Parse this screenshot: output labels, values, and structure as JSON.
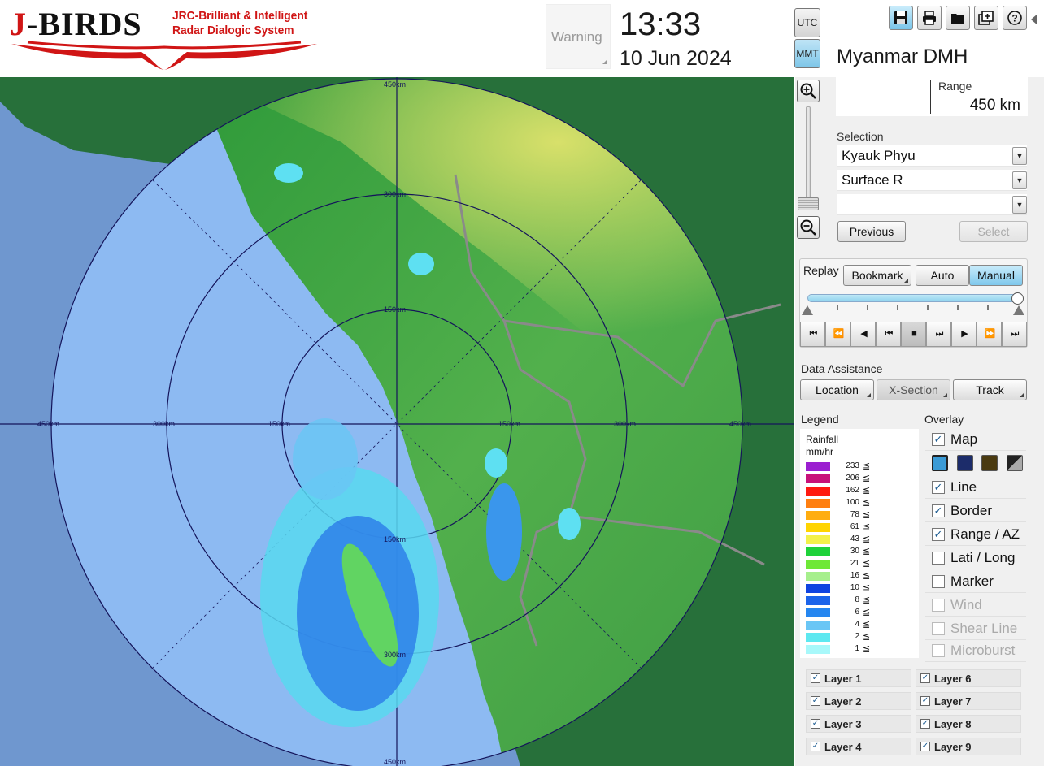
{
  "app": {
    "logo_main": "J-BIRDS",
    "logo_sub_line1": "JRC-Brilliant & Intelligent",
    "logo_sub_line2": "Radar Dialogic System"
  },
  "header": {
    "warning_label": "Warning",
    "time": "13:33",
    "date": "10 Jun 2024",
    "tz_utc": "UTC",
    "tz_mmt": "MMT",
    "active_tz": "MMT",
    "station": "Myanmar DMH",
    "tools": [
      "save-icon",
      "print-icon",
      "open-folder-icon",
      "add-window-icon",
      "help-icon"
    ]
  },
  "map": {
    "range_ring_labels": {
      "north": [
        "450km",
        "300km",
        "150km"
      ],
      "south": [
        "150km",
        "300km",
        "450km"
      ],
      "west": [
        "450km",
        "300km",
        "150km"
      ],
      "east": [
        "150km",
        "300km",
        "450km"
      ]
    }
  },
  "panel": {
    "range_label": "Range",
    "range_value": "450 km",
    "selection_label": "Selection",
    "selection_site": "Kyauk Phyu",
    "selection_product": "Surface R",
    "selection_third": "",
    "previous_label": "Previous",
    "select_label": "Select",
    "replay_label": "Replay",
    "bookmark_label": "Bookmark",
    "auto_label": "Auto",
    "manual_label": "Manual",
    "replay_mode": "Manual",
    "transport_buttons": [
      "⏮",
      "⏪",
      "◀",
      "⏮",
      "■",
      "⏭",
      "▶",
      "⏩",
      "⏭"
    ],
    "data_assistance_label": "Data Assistance",
    "location_label": "Location",
    "xsection_label": "X-Section",
    "track_label": "Track"
  },
  "legend": {
    "title": "Legend",
    "unit_line1": "Rainfall",
    "unit_line2": "mm/hr",
    "symbol": "≦",
    "entries": [
      {
        "value": "233",
        "color": "#9b1fd0"
      },
      {
        "value": "206",
        "color": "#c8127a"
      },
      {
        "value": "162",
        "color": "#ff1a10"
      },
      {
        "value": "100",
        "color": "#ff7f10"
      },
      {
        "value": "78",
        "color": "#ffad10"
      },
      {
        "value": "61",
        "color": "#ffd400"
      },
      {
        "value": "43",
        "color": "#f3f14a"
      },
      {
        "value": "30",
        "color": "#1ed23a"
      },
      {
        "value": "21",
        "color": "#6ee836"
      },
      {
        "value": "16",
        "color": "#a6ef8c"
      },
      {
        "value": "10",
        "color": "#1044e0"
      },
      {
        "value": "8",
        "color": "#1c64ea"
      },
      {
        "value": "6",
        "color": "#2586f0"
      },
      {
        "value": "4",
        "color": "#6ac6f5"
      },
      {
        "value": "2",
        "color": "#5ee8f0"
      },
      {
        "value": "1",
        "color": "#a8f8fa"
      }
    ]
  },
  "overlay": {
    "title": "Overlay",
    "items": [
      {
        "label": "Map",
        "checked": true,
        "enabled": true
      },
      {
        "label": "Line",
        "checked": true,
        "enabled": true
      },
      {
        "label": "Border",
        "checked": true,
        "enabled": true
      },
      {
        "label": "Range / AZ",
        "checked": true,
        "enabled": true
      },
      {
        "label": "Lati / Long",
        "checked": false,
        "enabled": true
      },
      {
        "label": "Marker",
        "checked": false,
        "enabled": true
      },
      {
        "label": "Wind",
        "checked": false,
        "enabled": false
      },
      {
        "label": "Shear Line",
        "checked": false,
        "enabled": false
      },
      {
        "label": "Microburst",
        "checked": false,
        "enabled": false
      }
    ],
    "map_styles": [
      "#3b9bd6",
      "#1c2c6a",
      "#4a3a10",
      "#333333"
    ]
  },
  "layers": {
    "left": [
      {
        "label": "Layer 1",
        "checked": true
      },
      {
        "label": "Layer 2",
        "checked": true
      },
      {
        "label": "Layer 3",
        "checked": true
      },
      {
        "label": "Layer 4",
        "checked": true
      }
    ],
    "right": [
      {
        "label": "Layer 6",
        "checked": true
      },
      {
        "label": "Layer 7",
        "checked": true
      },
      {
        "label": "Layer 8",
        "checked": true
      },
      {
        "label": "Layer 9",
        "checked": true
      }
    ]
  }
}
